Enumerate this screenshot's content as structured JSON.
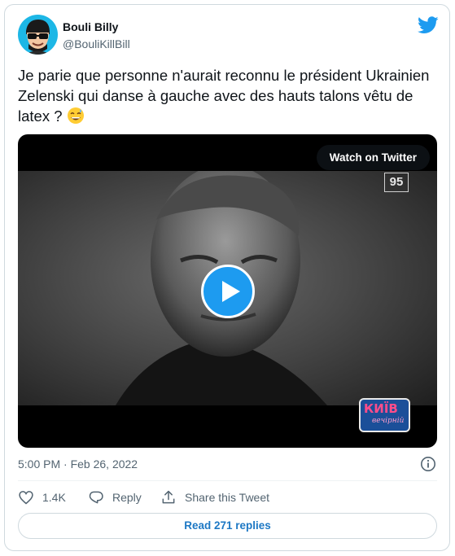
{
  "user": {
    "display_name": "Bouli Billy",
    "handle": "@BouliKillBill",
    "avatar_icon": "cartoon-avatar-sunglasses-icon",
    "avatar_bg": "#1db7e6"
  },
  "tweet": {
    "text": "Je parie que personne n'aurait reconnu le président Ukrainien Zelenski qui danse à gauche avec des hauts talons vêtu de latex ?",
    "emoji_icon": "grinning-face-with-sweat-icon",
    "timestamp": "5:00 PM · Feb 26, 2022"
  },
  "media": {
    "watch_label": "Watch on Twitter",
    "channel_badge": "95",
    "watermark_text": "КИЇВ",
    "watermark_sub": "вечірній",
    "play_icon": "play-icon"
  },
  "actions": {
    "like_count": "1.4K",
    "reply_label": "Reply",
    "share_label": "Share this Tweet"
  },
  "footer": {
    "read_replies": "Read 271 replies"
  },
  "colors": {
    "twitter_blue": "#1d9bf0",
    "link_blue": "#1d78c4",
    "secondary_text": "#536471",
    "border": "#cfd9de"
  }
}
